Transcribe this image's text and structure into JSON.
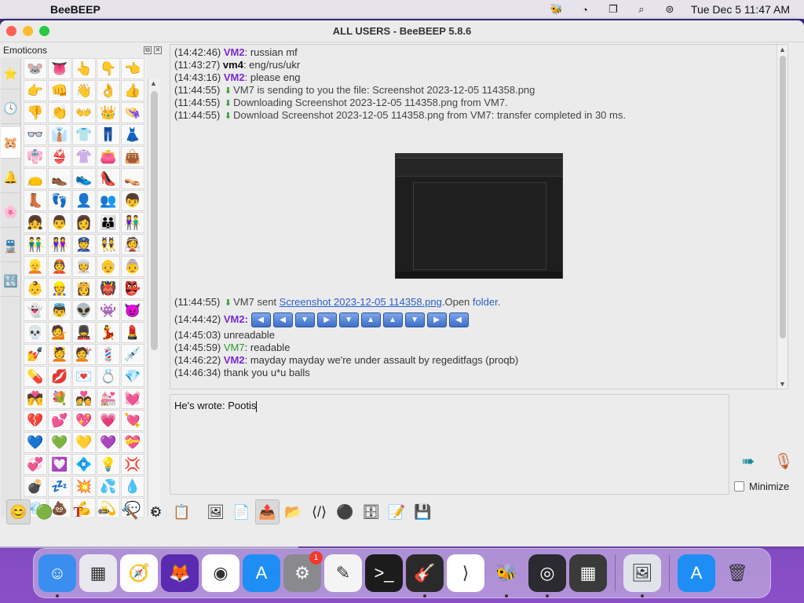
{
  "menubar": {
    "app_name": "BeeBEEP",
    "datetime": "Tue Dec 5  11:47 AM",
    "icons": [
      "beebeep-icon",
      "circle-arrow-icon",
      "window-stack-icon",
      "search-icon",
      "control-center-icon"
    ]
  },
  "window": {
    "title": "ALL USERS - BeeBEEP 5.8.6"
  },
  "emoticons": {
    "title": "Emoticons",
    "tabs": [
      "⭐",
      "🕓",
      "🐹",
      "🔔",
      "🌸",
      "🚆",
      "🔣"
    ],
    "items": [
      "🐭",
      "👅",
      "👆",
      "👇",
      "👈",
      "👉",
      "👊",
      "👋",
      "👌",
      "👍",
      "👎",
      "👏",
      "👐",
      "👑",
      "👒",
      "👓",
      "👔",
      "👕",
      "👖",
      "👗",
      "👘",
      "👙",
      "👚",
      "👛",
      "👜",
      "👝",
      "👞",
      "👟",
      "👠",
      "👡",
      "👢",
      "👣",
      "👤",
      "👥",
      "👦",
      "👧",
      "👨",
      "👩",
      "👪",
      "👫",
      "👬",
      "👭",
      "👮",
      "👯",
      "👰",
      "👱",
      "👲",
      "👳",
      "👴",
      "👵",
      "👶",
      "👷",
      "👸",
      "👹",
      "👺",
      "👻",
      "👼",
      "👽",
      "👾",
      "👿",
      "💀",
      "💁",
      "💂",
      "💃",
      "💄",
      "💅",
      "💆",
      "💇",
      "💈",
      "💉",
      "💊",
      "💋",
      "💌",
      "💍",
      "💎",
      "💏",
      "💐",
      "💑",
      "💒",
      "💓",
      "💔",
      "💕",
      "💖",
      "💗",
      "💘",
      "💙",
      "💚",
      "💛",
      "💜",
      "💝",
      "💞",
      "💟",
      "💠",
      "💡",
      "💢",
      "💣",
      "💤",
      "💥",
      "💦",
      "💧",
      "💨",
      "💩",
      "💪",
      "💫",
      "💬",
      "🔥",
      "👥",
      "👬",
      "👫",
      "💭",
      "🌟",
      "🤮"
    ]
  },
  "chat": {
    "lines": [
      {
        "ts": "(14:42:46)",
        "nick": "VM2",
        "nick_type": "vm2",
        "text": ": russian mf"
      },
      {
        "ts": "(11:43:27)",
        "nick": "vm4",
        "nick_type": "vm4",
        "text": ": eng/rus/ukr"
      },
      {
        "ts": "(14:43:16)",
        "nick": "VM2",
        "nick_type": "vm2",
        "text": ": please eng"
      },
      {
        "ts": "(11:44:55)",
        "sys": "VM7 is sending to you the file: Screenshot 2023-12-05 114358.png"
      },
      {
        "ts": "(11:44:55)",
        "sys": "Downloading Screenshot 2023-12-05 114358.png from VM7."
      },
      {
        "ts": "(11:44:55)",
        "sys": "Download Screenshot 2023-12-05 114358.png from VM7: transfer completed in 30 ms."
      }
    ],
    "sent_line": {
      "ts": "(11:44:55)",
      "prefix": "VM7 sent ",
      "file_link": "Screenshot 2023-12-05 114358.png",
      "open_text": ".Open ",
      "folder_link": "folder",
      "suffix": "."
    },
    "arrow_line": {
      "ts": "(14:44:42)",
      "nick": "VM2",
      "colon": ":",
      "arrows": [
        "◀",
        "◀",
        "▼",
        "▶",
        "▼",
        "▲",
        "▲",
        "▼",
        "▶",
        "◀"
      ]
    },
    "tail_lines": [
      {
        "ts": "(14:45:03)",
        "nick": "",
        "nick_type": "",
        "text": "   unreadable"
      },
      {
        "ts": "(14:45:59)",
        "nick": "VM7",
        "nick_type": "vm7",
        "text": ": readable"
      },
      {
        "ts": "(14:46:22)",
        "nick": "VM2",
        "nick_type": "vm2",
        "text": ": mayday mayday we're under assault by regeditfags (proqb)"
      },
      {
        "ts": "(14:46:34)",
        "nick": "",
        "nick_type": "",
        "text": "   thank you u*u balls"
      }
    ]
  },
  "input": {
    "value": "He's wrote: Pootis"
  },
  "minimize_label": "Minimize",
  "toolbar": {
    "buttons": [
      "😊",
      "🟢",
      "T",
      "✏",
      "🔨",
      "⚙",
      "📋",
      "🖼",
      "📄",
      "📤",
      "📂",
      "⟨/⟩",
      "⚫",
      "🗄",
      "📝",
      "💾"
    ]
  },
  "dock": {
    "items": [
      {
        "name": "finder",
        "glyph": "☺",
        "bg": "#3a8ef0",
        "dot": true
      },
      {
        "name": "launchpad",
        "glyph": "▦",
        "bg": "#e8e8ee",
        "dot": false
      },
      {
        "name": "safari",
        "glyph": "🧭",
        "bg": "#ffffff",
        "dot": false
      },
      {
        "name": "firefox",
        "glyph": "🦊",
        "bg": "#5a2ab0",
        "dot": false
      },
      {
        "name": "chrome",
        "glyph": "◉",
        "bg": "#ffffff",
        "dot": false
      },
      {
        "name": "app-store",
        "glyph": "A",
        "bg": "#1e8ef5",
        "dot": false
      },
      {
        "name": "system-settings",
        "glyph": "⚙",
        "bg": "#8a8a8e",
        "dot": false,
        "badge": "1"
      },
      {
        "name": "textedit",
        "glyph": "✎",
        "bg": "#f4f4f4",
        "dot": false
      },
      {
        "name": "terminal",
        "glyph": ">_",
        "bg": "#1c1c1c",
        "dot": false
      },
      {
        "name": "garageband",
        "glyph": "🎸",
        "bg": "#2a2a2a",
        "dot": true
      },
      {
        "name": "vscode",
        "glyph": "⟩",
        "bg": "#ffffff",
        "dot": false
      },
      {
        "name": "beebeep",
        "glyph": "🐝",
        "bg": "transparent",
        "dot": true
      },
      {
        "name": "obs",
        "glyph": "◎",
        "bg": "#2a2a30",
        "dot": true
      },
      {
        "name": "calculator",
        "glyph": "▦",
        "bg": "#3a3a3a",
        "dot": false
      },
      {
        "name": "preview",
        "glyph": "🖼",
        "bg": "#e0e4ea",
        "dot": true
      },
      {
        "name": "app-store-2",
        "glyph": "A",
        "bg": "#1e8ef5",
        "dot": false
      },
      {
        "name": "trash",
        "glyph": "🗑",
        "bg": "transparent",
        "dot": false
      }
    ]
  }
}
